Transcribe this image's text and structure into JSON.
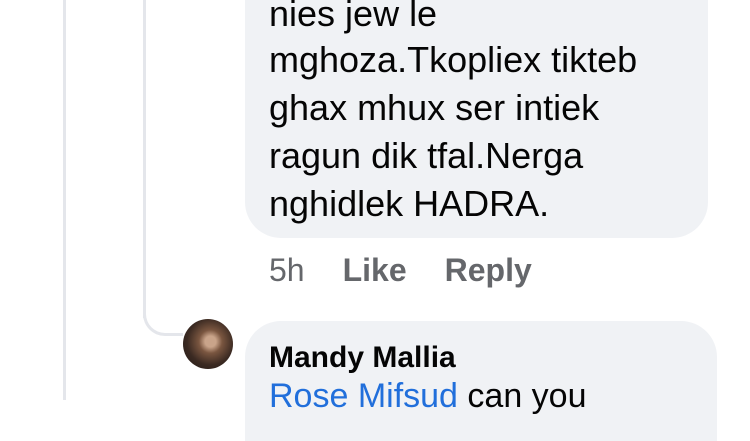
{
  "comment": {
    "lines": [
      "nies jew le",
      "mghoza.Tkopliex tikteb",
      "ghax mhux ser intiek",
      "ragun dik tfal.Nerga",
      "nghidlek HADRA."
    ],
    "time": "5h",
    "like_label": "Like",
    "reply_label": "Reply"
  },
  "reply": {
    "author": "Mandy Mallia",
    "mention": "Rose Mifsud",
    "text": " can you"
  }
}
